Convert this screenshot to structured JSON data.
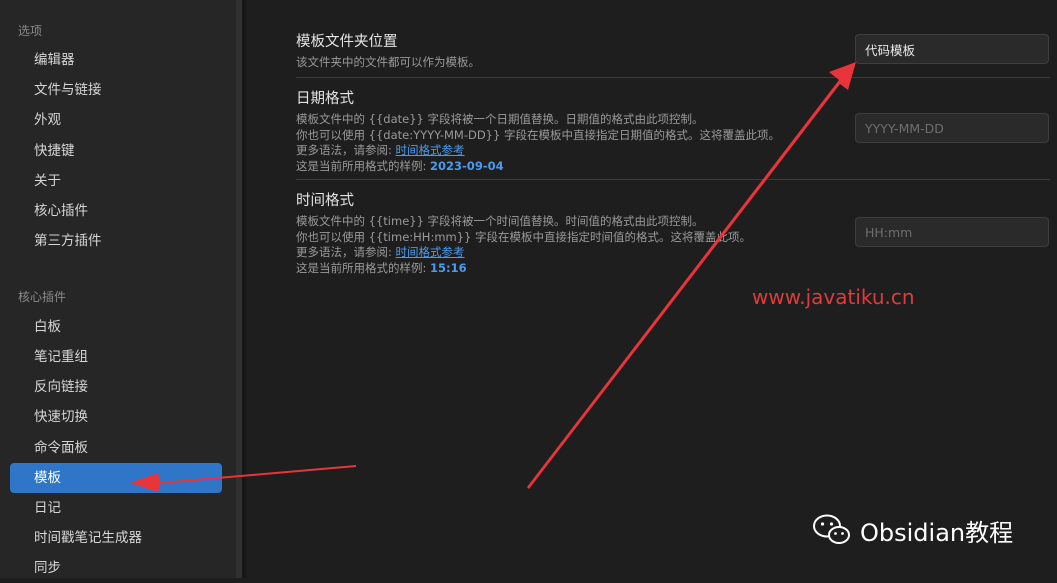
{
  "sidebar": {
    "options_title": "选项",
    "options_items": [
      "编辑器",
      "文件与链接",
      "外观",
      "快捷键",
      "关于",
      "核心插件",
      "第三方插件"
    ],
    "core_title": "核心插件",
    "core_items": [
      "白板",
      "笔记重组",
      "反向链接",
      "快速切换",
      "命令面板",
      "模板",
      "日记",
      "时间戳笔记生成器",
      "同步"
    ],
    "active_item": "模板"
  },
  "settings": {
    "folder": {
      "name": "模板文件夹位置",
      "desc": "该文件夹中的文件都可以作为模板。",
      "value": "代码模板"
    },
    "date": {
      "name": "日期格式",
      "desc1": "模板文件中的 {{date}} 字段将被一个日期值替换。日期值的格式由此项控制。",
      "desc2": "你也可以使用 {{date:YYYY-MM-DD}} 字段在模板中直接指定日期值的格式。这将覆盖此项。",
      "more": "更多语法，请参阅: ",
      "link": "时间格式参考",
      "sample_label": "这是当前所用格式的样例: ",
      "sample": "2023-09-04",
      "placeholder": "YYYY-MM-DD"
    },
    "time": {
      "name": "时间格式",
      "desc1": "模板文件中的 {{time}} 字段将被一个时间值替换。时间值的格式由此项控制。",
      "desc2": "你也可以使用 {{time:HH:mm}} 字段在模板中直接指定时间值的格式。这将覆盖此项。",
      "more": "更多语法，请参阅: ",
      "link": "时间格式参考",
      "sample_label": "这是当前所用格式的样例: ",
      "sample": "15:16",
      "placeholder": "HH:mm"
    }
  },
  "overlay": {
    "watermark": "www.javatiku.cn",
    "brand": "Obsidian教程",
    "brand_icon": "wechat-icon",
    "arrow_color": "#e8343a"
  }
}
